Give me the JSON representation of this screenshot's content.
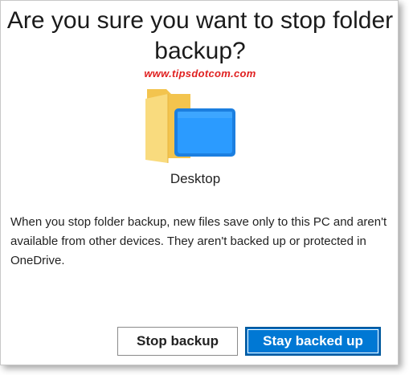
{
  "dialog": {
    "title": "Are you sure you want to stop folder backup?",
    "watermark": "www.tipsdotcom.com",
    "folder": {
      "icon": "desktop-folder-icon",
      "label": "Desktop"
    },
    "message": "When you stop folder backup, new files save only to this PC and aren't available from other devices. They aren't backed up or protected in OneDrive.",
    "buttons": {
      "stop_label": "Stop backup",
      "stay_label": "Stay backed up"
    }
  },
  "colors": {
    "primary_button": "#0078d4",
    "folder_yellow": "#f7d36b",
    "screen_blue": "#1e90ff",
    "watermark": "#e02020"
  }
}
